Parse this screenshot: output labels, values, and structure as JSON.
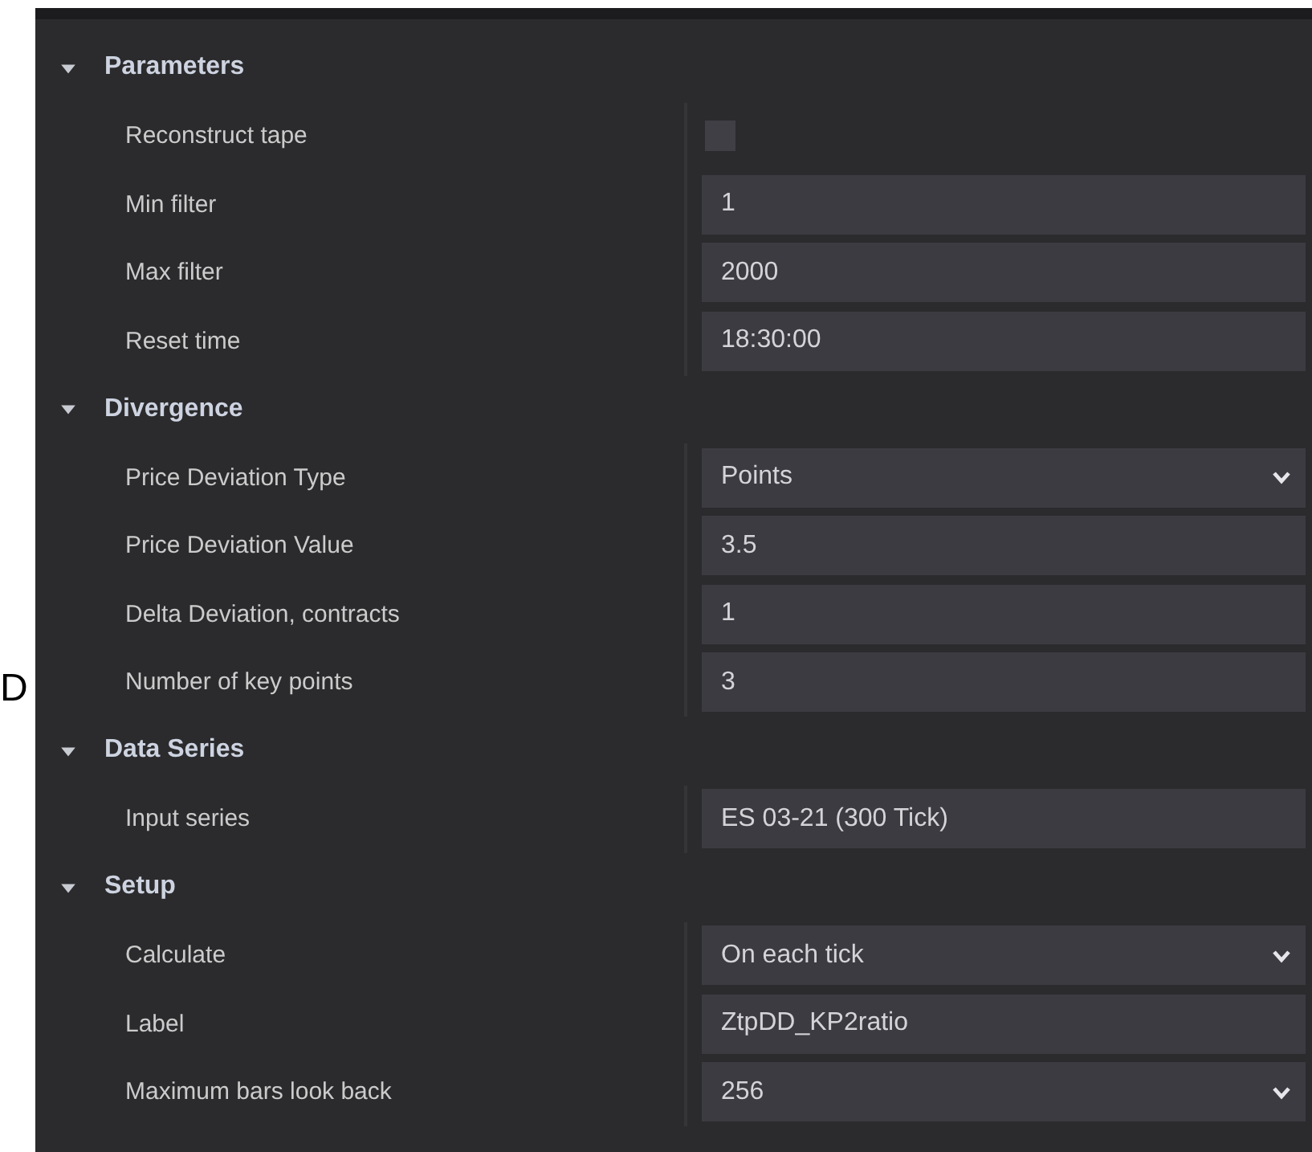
{
  "side_label": "D",
  "sections": [
    {
      "title": "Parameters",
      "expanded": true,
      "rows": [
        {
          "label": "Reconstruct tape",
          "kind": "checkbox",
          "checked": false
        },
        {
          "label": "Min filter",
          "kind": "text",
          "value": "1"
        },
        {
          "label": "Max filter",
          "kind": "text",
          "value": "2000"
        },
        {
          "label": "Reset time",
          "kind": "text",
          "value": "18:30:00"
        }
      ]
    },
    {
      "title": "Divergence",
      "expanded": true,
      "rows": [
        {
          "label": "Price Deviation Type",
          "kind": "dropdown",
          "value": "Points"
        },
        {
          "label": "Price Deviation Value",
          "kind": "text",
          "value": "3.5"
        },
        {
          "label": "Delta Deviation, contracts",
          "kind": "text",
          "value": "1"
        },
        {
          "label": "Number of key points",
          "kind": "text",
          "value": "3"
        }
      ]
    },
    {
      "title": "Data Series",
      "expanded": true,
      "rows": [
        {
          "label": "Input series",
          "kind": "text",
          "value": "ES 03-21 (300 Tick)"
        }
      ]
    },
    {
      "title": "Setup",
      "expanded": true,
      "rows": [
        {
          "label": "Calculate",
          "kind": "dropdown",
          "value": "On each tick"
        },
        {
          "label": "Label",
          "kind": "text",
          "value": "ZtpDD_KP2ratio"
        },
        {
          "label": "Maximum bars look back",
          "kind": "dropdown",
          "value": "256"
        }
      ]
    }
  ]
}
